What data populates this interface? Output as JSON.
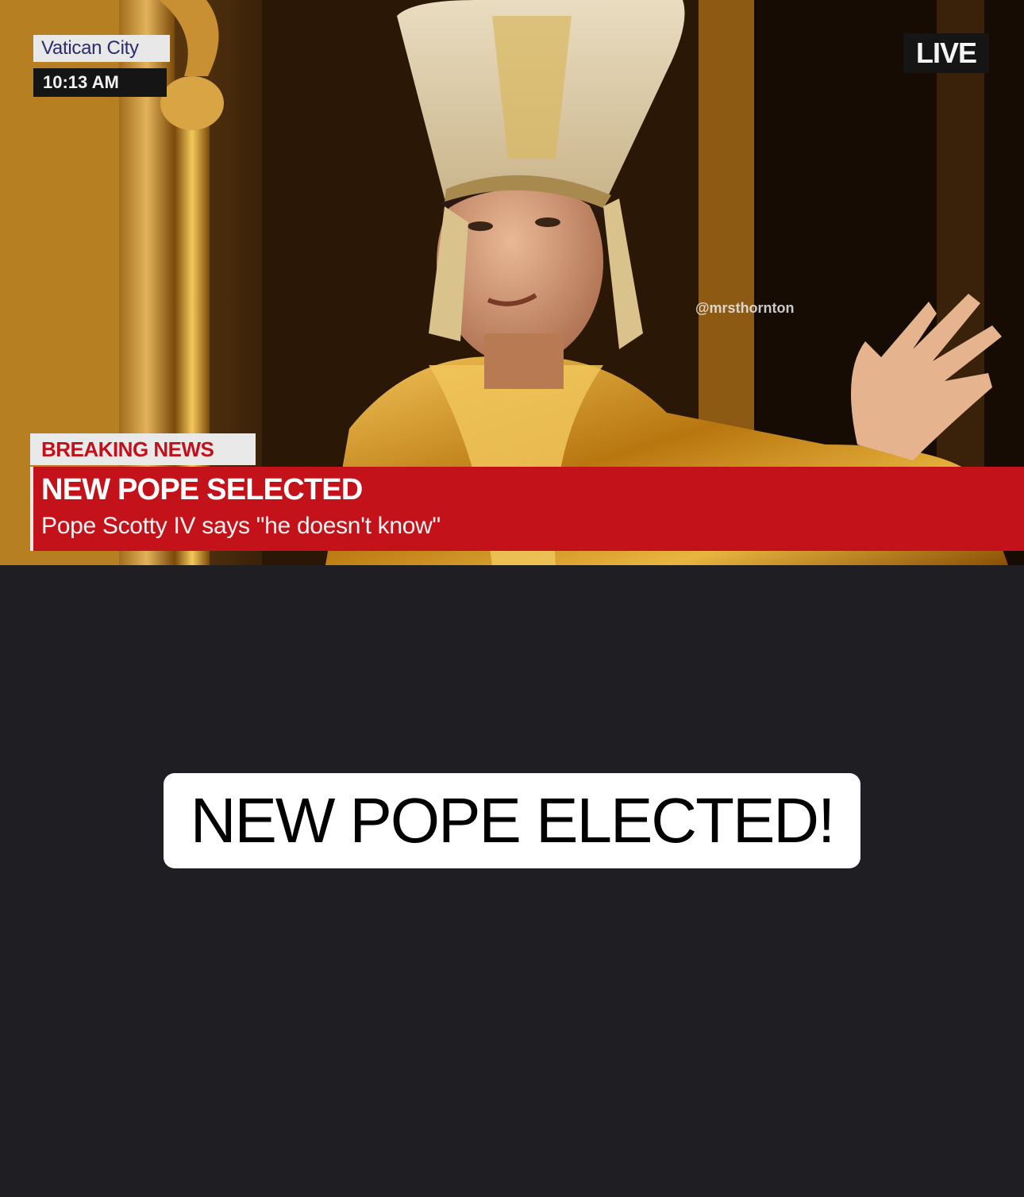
{
  "news_image": {
    "location": "Vatican City",
    "time": "10:13 AM",
    "live_label": "LIVE",
    "watermark": "@mrsthornton",
    "breaking_label": "BREAKING NEWS",
    "headline": "NEW POPE SELECTED",
    "subheadline": "Pope Scotty IV says \"he doesn't know\""
  },
  "caption": {
    "text": "NEW POPE ELECTED!"
  },
  "colors": {
    "background": "#1f1f23",
    "news_red": "#c4121a",
    "caption_bg": "#ffffff"
  }
}
